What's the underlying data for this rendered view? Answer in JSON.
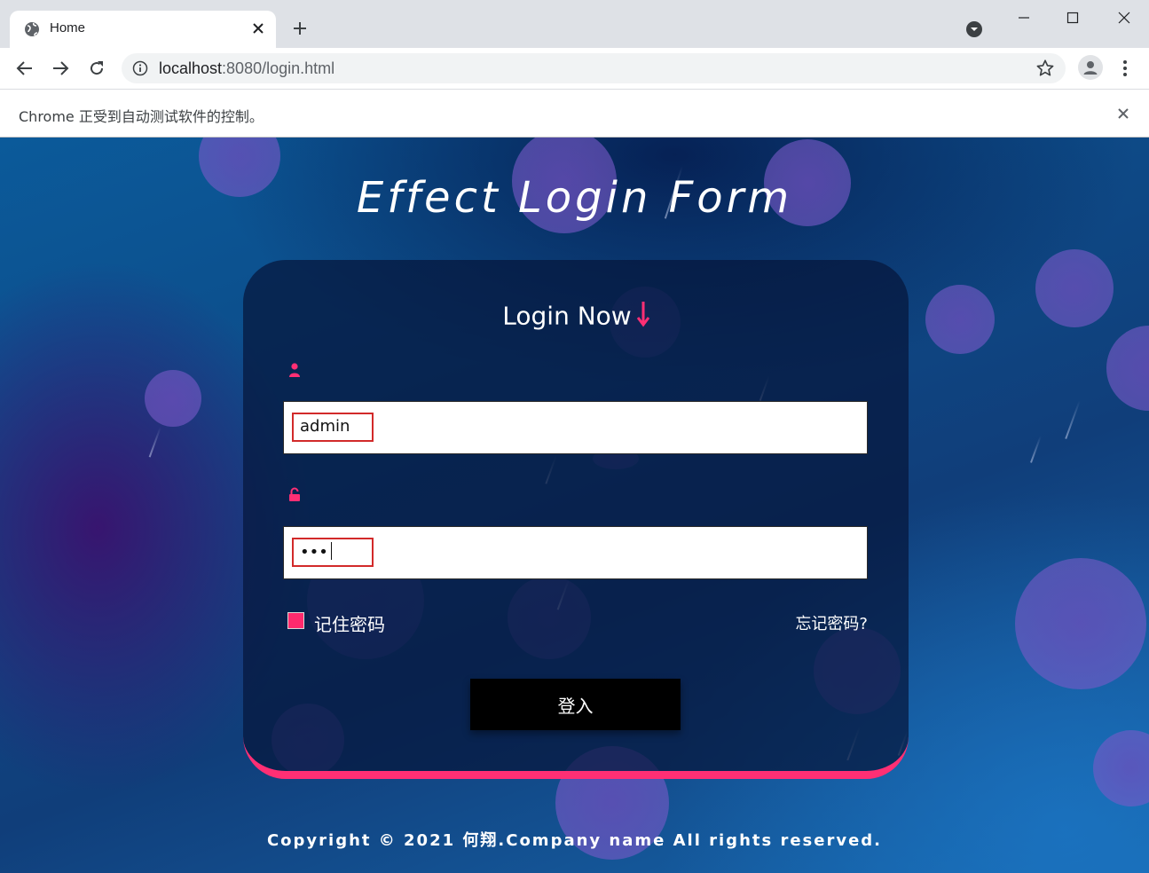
{
  "browser": {
    "tab_title": "Home",
    "url_host": "localhost",
    "url_rest": ":8080/login.html",
    "infobar_text": "Chrome 正受到自动测试软件的控制。"
  },
  "page": {
    "title": "Effect Login Form",
    "card_heading": "Login Now",
    "username_value": "admin",
    "password_value": "•••",
    "remember_label": "记住密码",
    "forgot_label": "忘记密码?",
    "login_button": "登入",
    "copyright": "Copyright © 2021 何翔.Company name All rights reserved.",
    "remember_checked": true
  },
  "colors": {
    "accent": "#ff2f74",
    "field_highlight": "#d22a2a",
    "button_bg": "#000000"
  },
  "icons": [
    "globe-icon",
    "close-icon",
    "plus-icon",
    "tab-search-icon",
    "minimize-icon",
    "maximize-icon",
    "back-arrow-icon",
    "forward-arrow-icon",
    "reload-icon",
    "info-icon",
    "star-icon",
    "profile-icon",
    "menu-icon",
    "down-arrow-icon",
    "user-icon",
    "lock-icon"
  ]
}
